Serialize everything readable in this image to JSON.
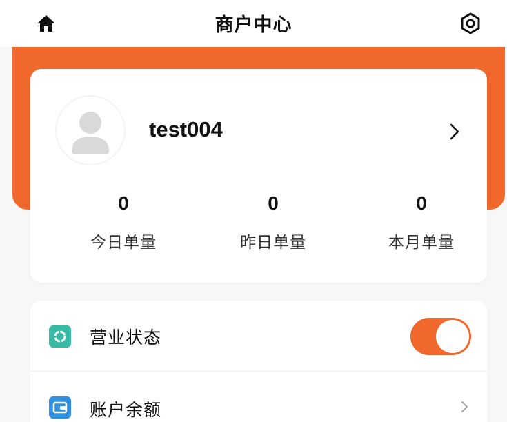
{
  "header": {
    "title": "商户中心",
    "left_icon": "home-icon",
    "right_icon": "settings-icon"
  },
  "colors": {
    "accent": "#f0682c",
    "status_icon": "#36b9a5",
    "balance_icon": "#2f8fe0"
  },
  "profile": {
    "username": "test004",
    "avatar_icon": "avatar-placeholder-icon",
    "chevron_icon": "chevron-right-icon"
  },
  "stats": [
    {
      "value": "0",
      "label": "今日单量"
    },
    {
      "value": "0",
      "label": "昨日单量"
    },
    {
      "value": "0",
      "label": "本月单量"
    }
  ],
  "menu": {
    "items": [
      {
        "label": "营业状态",
        "icon": "business-status-icon",
        "control": "toggle",
        "toggle_on": true
      },
      {
        "label": "账户余额",
        "icon": "wallet-icon",
        "control": "chevron"
      }
    ]
  }
}
